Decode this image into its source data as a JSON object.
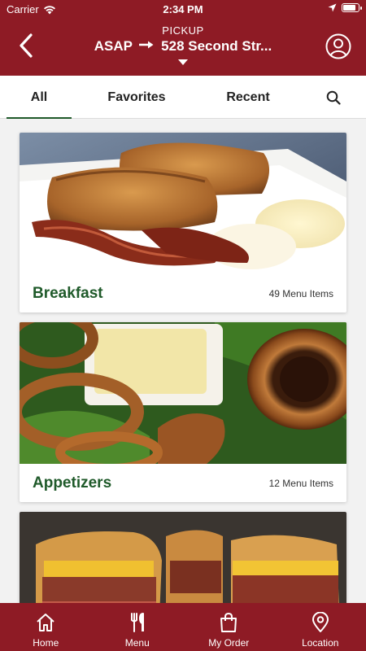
{
  "status": {
    "carrier": "Carrier",
    "time": "2:34 PM"
  },
  "header": {
    "mode_label": "PICKUP",
    "when": "ASAP",
    "address": "528 Second Str..."
  },
  "tabs": [
    {
      "label": "All",
      "active": true
    },
    {
      "label": "Favorites",
      "active": false
    },
    {
      "label": "Recent",
      "active": false
    }
  ],
  "categories": [
    {
      "name": "Breakfast",
      "count": "49 Menu Items"
    },
    {
      "name": "Appetizers",
      "count": "12 Menu Items"
    }
  ],
  "bottom_nav": [
    {
      "label": "Home",
      "icon": "home-icon"
    },
    {
      "label": "Menu",
      "icon": "fork-knife-icon"
    },
    {
      "label": "My Order",
      "icon": "shopping-bag-icon"
    },
    {
      "label": "Location",
      "icon": "location-pin-icon"
    }
  ],
  "colors": {
    "brand": "#8e1b25",
    "accent_green": "#1f5a2a",
    "background": "#f2f2f2"
  }
}
